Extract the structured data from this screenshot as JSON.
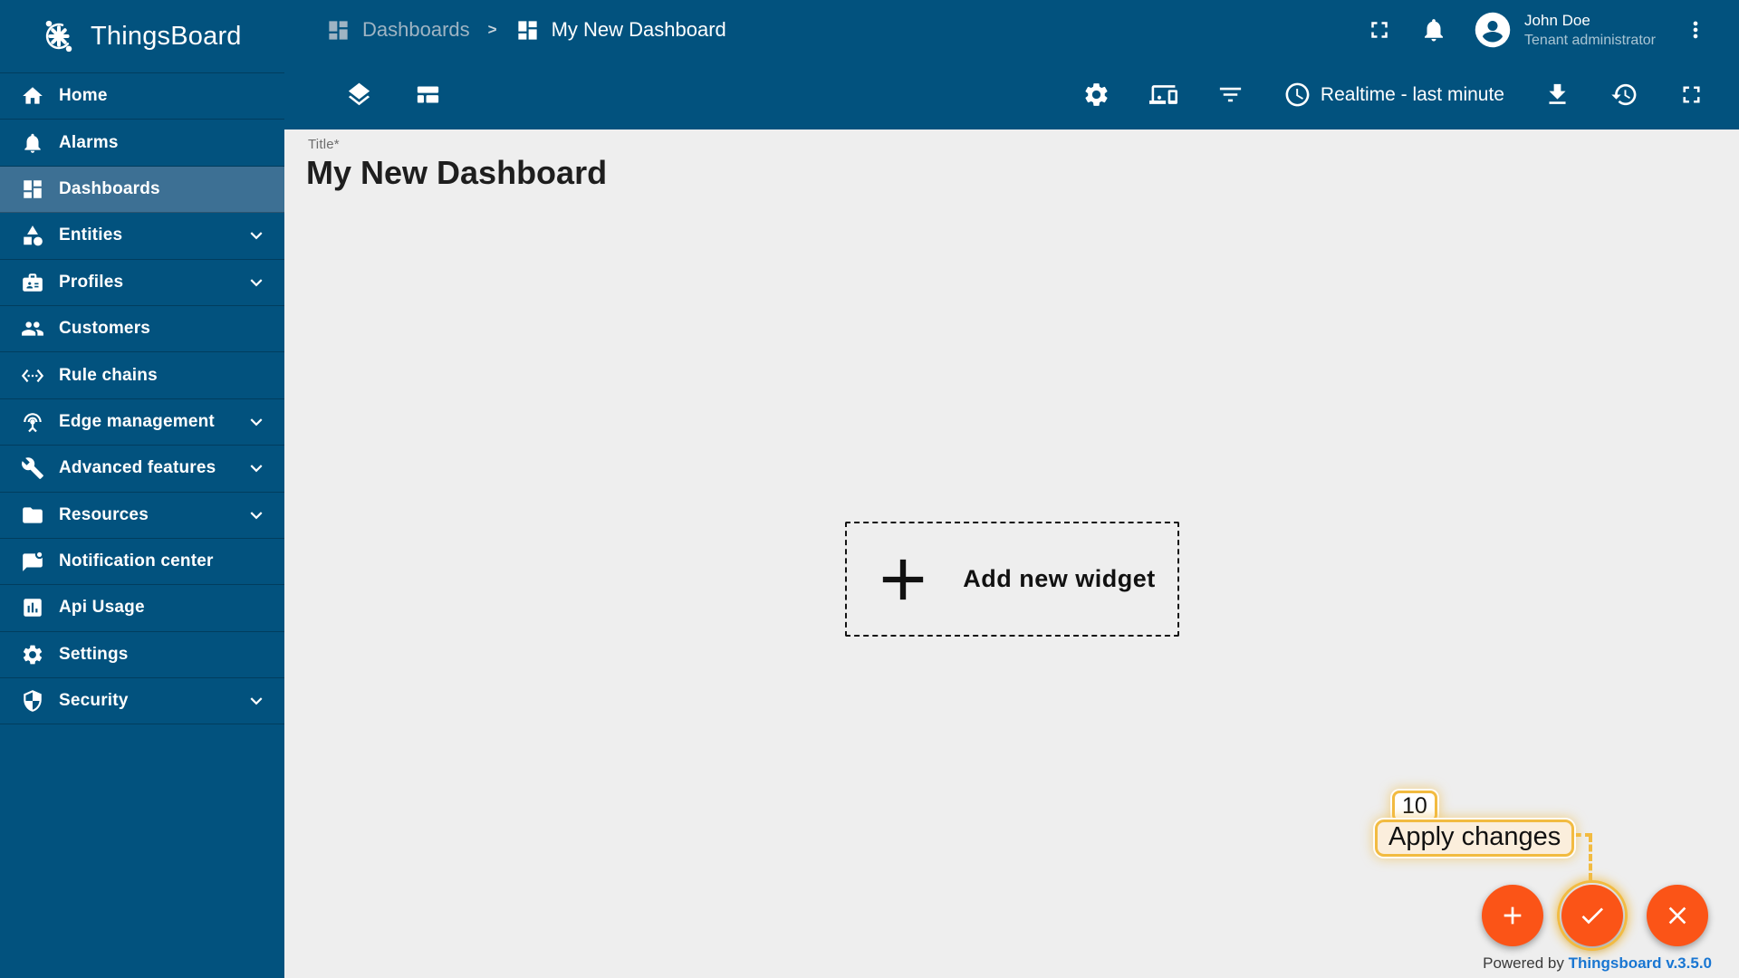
{
  "app": {
    "name": "ThingsBoard",
    "logo_icon": "thingsboard-logo-icon"
  },
  "colors": {
    "primary": "#02527E",
    "selected_item": "#3D7094",
    "content_bg": "#EEEEEE",
    "fab_orange": "#FB5417",
    "annotation_gold": "#F2BB41",
    "annotation_bg": "#FBEEDC",
    "link_blue": "#1976D2"
  },
  "sidebar": {
    "items": [
      {
        "label": "Home",
        "icon": "home-icon",
        "selected": false,
        "chevron": false
      },
      {
        "label": "Alarms",
        "icon": "alarms-icon",
        "selected": false,
        "chevron": false
      },
      {
        "label": "Dashboards",
        "icon": "dashboards-icon",
        "selected": true,
        "chevron": false
      },
      {
        "label": "Entities",
        "icon": "entities-icon",
        "selected": false,
        "chevron": true
      },
      {
        "label": "Profiles",
        "icon": "profiles-icon",
        "selected": false,
        "chevron": true
      },
      {
        "label": "Customers",
        "icon": "customers-icon",
        "selected": false,
        "chevron": false
      },
      {
        "label": "Rule chains",
        "icon": "rule-chains-icon",
        "selected": false,
        "chevron": false
      },
      {
        "label": "Edge management",
        "icon": "edge-management-icon",
        "selected": false,
        "chevron": true
      },
      {
        "label": "Advanced features",
        "icon": "advanced-features-icon",
        "selected": false,
        "chevron": true
      },
      {
        "label": "Resources",
        "icon": "resources-icon",
        "selected": false,
        "chevron": true
      },
      {
        "label": "Notification center",
        "icon": "notification-center-icon",
        "selected": false,
        "chevron": false
      },
      {
        "label": "Api Usage",
        "icon": "api-usage-icon",
        "selected": false,
        "chevron": false
      },
      {
        "label": "Settings",
        "icon": "settings-icon",
        "selected": false,
        "chevron": false
      },
      {
        "label": "Security",
        "icon": "security-icon",
        "selected": false,
        "chevron": true
      }
    ]
  },
  "header": {
    "breadcrumb": [
      {
        "label": "Dashboards",
        "icon": "dashboards-icon",
        "muted": true
      },
      {
        "label": "My New Dashboard",
        "icon": "dashboards-icon",
        "muted": false
      }
    ],
    "separator": ">",
    "actions": [
      {
        "icon": "fullscreen-icon"
      },
      {
        "icon": "notifications-icon"
      }
    ],
    "user": {
      "name": "John Doe",
      "role": "Tenant administrator",
      "avatar_icon": "account-icon"
    },
    "menu_icon": "more-vert-icon"
  },
  "toolbar": {
    "left_icons": [
      {
        "icon": "layers-icon"
      },
      {
        "icon": "manage-layouts-icon"
      }
    ],
    "right_icons": [
      {
        "icon": "settings-icon"
      },
      {
        "icon": "devices-icon"
      },
      {
        "icon": "filter-icon"
      }
    ],
    "timewindow": {
      "icon": "clock-icon",
      "label": "Realtime - last minute"
    },
    "far_right_icons": [
      {
        "icon": "download-icon"
      },
      {
        "icon": "history-icon"
      },
      {
        "icon": "fullscreen-icon"
      }
    ]
  },
  "main": {
    "title_label": "Title*",
    "title": "My New Dashboard",
    "add_widget_label": "Add new widget",
    "add_widget_icon": "plus-icon"
  },
  "fabs": [
    {
      "name": "add-widget-fab",
      "icon": "plus-icon",
      "highlighted": false
    },
    {
      "name": "apply-changes-fab",
      "icon": "check-icon",
      "highlighted": true
    },
    {
      "name": "cancel-changes-fab",
      "icon": "close-icon",
      "highlighted": false
    }
  ],
  "annotation": {
    "badge": "10",
    "label": "Apply changes"
  },
  "footer": {
    "powered_by": "Powered by ",
    "brand": "Thingsboard v.3.5.0"
  }
}
